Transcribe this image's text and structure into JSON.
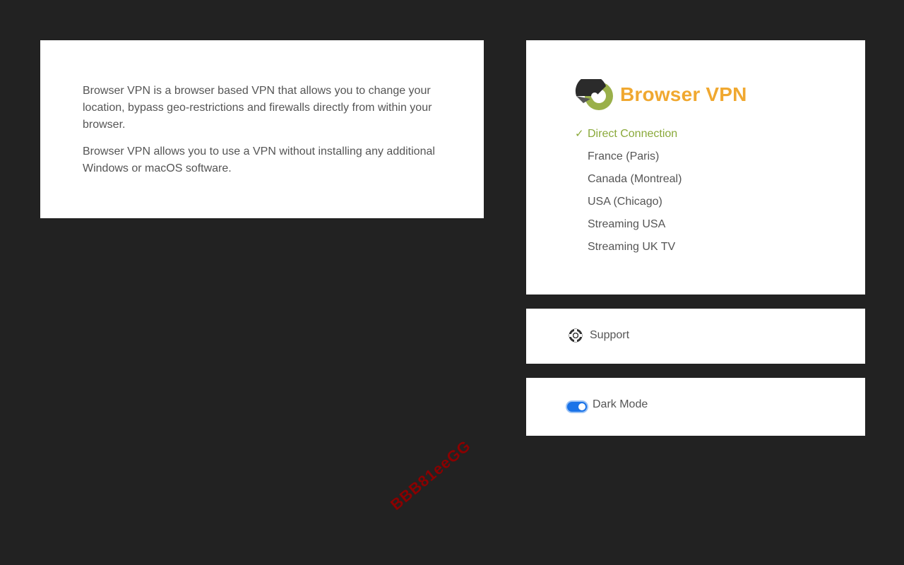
{
  "about": {
    "paragraphs": [
      "Browser VPN is a browser based VPN that allows you to change your location, bypass geo-restrictions and firewalls directly from within your browser.",
      "Browser VPN allows you to use a VPN without installing any additional Windows or macOS software."
    ]
  },
  "vpn": {
    "brand_name": "Browser VPN",
    "check_mark": "✓",
    "servers": [
      {
        "label": "Direct Connection",
        "selected": true
      },
      {
        "label": "France (Paris)",
        "selected": false
      },
      {
        "label": "Canada (Montreal)",
        "selected": false
      },
      {
        "label": "USA (Chicago)",
        "selected": false
      },
      {
        "label": "Streaming USA",
        "selected": false
      },
      {
        "label": "Streaming UK TV",
        "selected": false
      }
    ]
  },
  "support": {
    "label": "Support",
    "icon": "lifebuoy-icon"
  },
  "dark_mode": {
    "label": "Dark Mode",
    "enabled": true
  },
  "watermark": {
    "text": "BBB81eeGG"
  },
  "colors": {
    "background": "#222222",
    "brand": "#f0a830",
    "selected": "#8aa93a",
    "toggle": "#1a73e8"
  }
}
